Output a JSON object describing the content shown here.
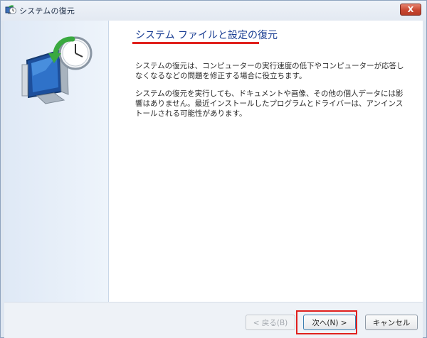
{
  "window": {
    "title": "システムの復元",
    "close_symbol": "X"
  },
  "content": {
    "heading": "システム ファイルと設定の復元",
    "paragraph1": "システムの復元は、コンピューターの実行速度の低下やコンピューターが応答しなくなるなどの問題を修正する場合に役立ちます。",
    "paragraph2": "システムの復元を実行しても、ドキュメントや画像、その他の個人データには影響はありません。最近インストールしたプログラムとドライバーは、アンインストールされる可能性があります。"
  },
  "footer": {
    "back_label": "< 戻る(B)",
    "next_label": "次へ(N) >",
    "cancel_label": "キャンセル"
  },
  "icons": {
    "app": "system-restore-icon",
    "hero": "system-restore-clock-icon"
  },
  "colors": {
    "heading": "#1a3e93",
    "annotation_red": "#e0201d",
    "close_button": "#c94731"
  }
}
